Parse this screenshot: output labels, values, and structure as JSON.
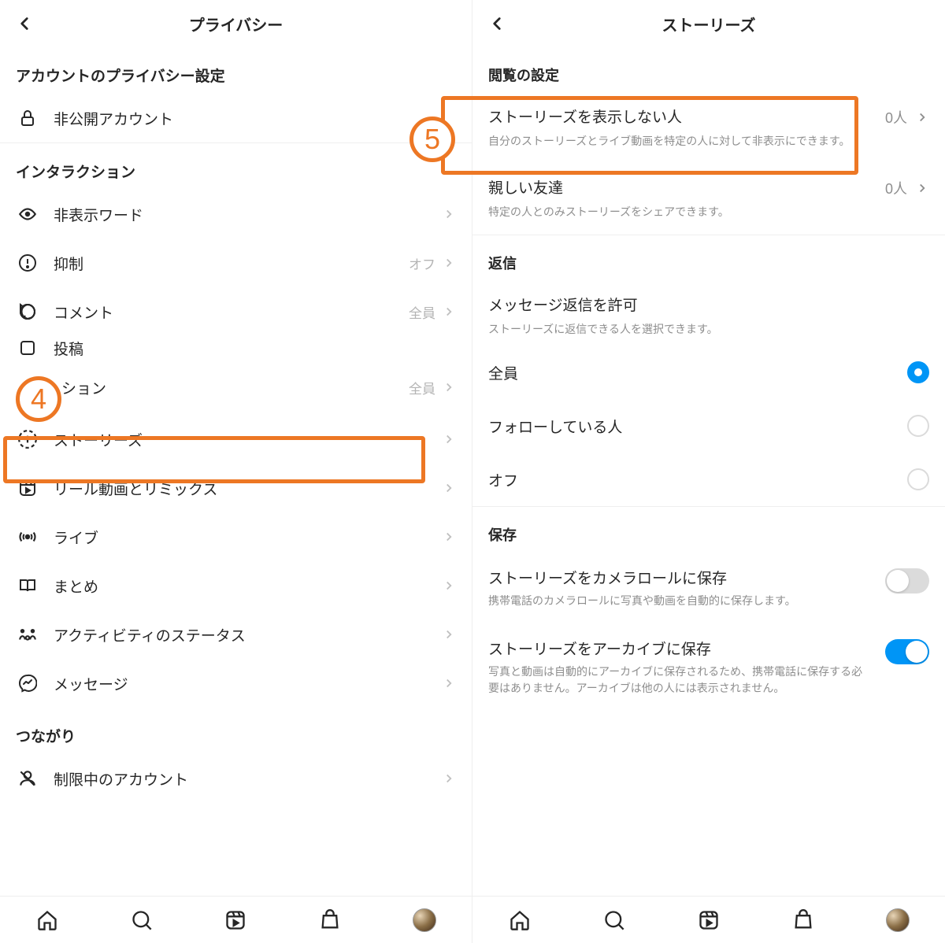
{
  "annotations": {
    "num4": "4",
    "num5": "5"
  },
  "left": {
    "header_title": "プライバシー",
    "section_account": "アカウントのプライバシー設定",
    "private_account": "非公開アカウント",
    "section_interaction": "インタラクション",
    "items": {
      "hidden_words": {
        "label": "非表示ワード"
      },
      "limits": {
        "label": "抑制",
        "value": "オフ"
      },
      "comments": {
        "label": "コメント",
        "value": "全員"
      },
      "posts_partial": {
        "label": "投稿"
      },
      "mention_partial": {
        "label": "ション",
        "value": "全員"
      },
      "stories": {
        "label": "ストーリーズ"
      },
      "reels": {
        "label": "リール動画とリミックス"
      },
      "live": {
        "label": "ライブ"
      },
      "guides": {
        "label": "まとめ"
      },
      "activity": {
        "label": "アクティビティのステータス"
      },
      "messages": {
        "label": "メッセージ"
      }
    },
    "section_connections": "つながり",
    "restricted": {
      "label": "制限中のアカウント"
    }
  },
  "right": {
    "header_title": "ストーリーズ",
    "section_view": "閲覧の設定",
    "hide_from": {
      "title": "ストーリーズを表示しない人",
      "desc": "自分のストーリーズとライブ動画を特定の人に対して非表示にできます。",
      "count": "0人"
    },
    "close_friends": {
      "title": "親しい友達",
      "desc": "特定の人とのみストーリーズをシェアできます。",
      "count": "0人"
    },
    "section_reply": "返信",
    "reply_allow": {
      "title": "メッセージ返信を許可",
      "desc": "ストーリーズに返信できる人を選択できます。"
    },
    "reply_options": {
      "everyone": "全員",
      "following": "フォローしている人",
      "off": "オフ"
    },
    "section_save": "保存",
    "save_camera": {
      "title": "ストーリーズをカメラロールに保存",
      "desc": "携帯電話のカメラロールに写真や動画を自動的に保存します。"
    },
    "save_archive": {
      "title": "ストーリーズをアーカイブに保存",
      "desc": "写真と動画は自動的にアーカイブに保存されるため、携帯電話に保存する必要はありません。アーカイブは他の人には表示されません。"
    }
  }
}
